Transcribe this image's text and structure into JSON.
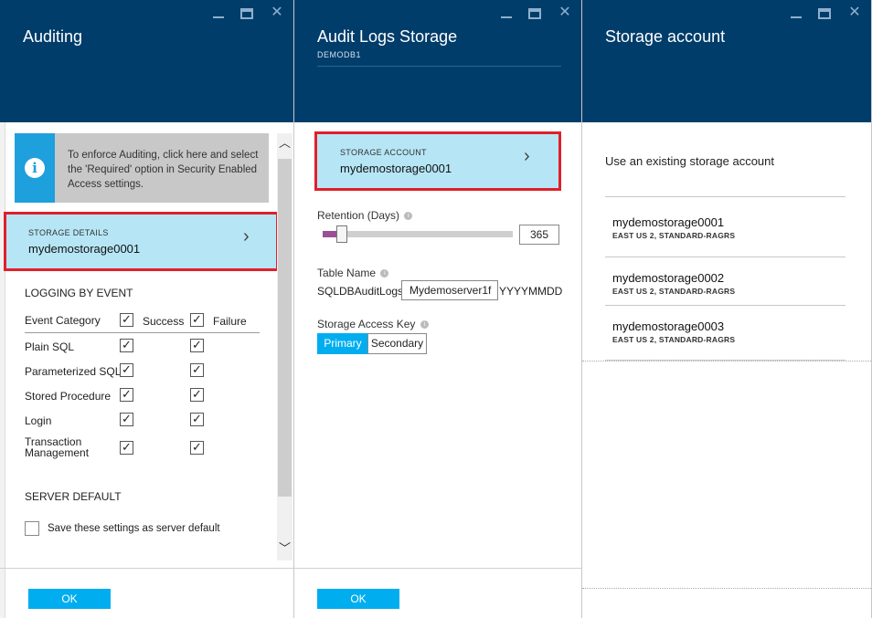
{
  "blade_auditing": {
    "title": "Auditing",
    "info_text": "To enforce Auditing, click here and select the 'Required' option in Security Enabled Access settings.",
    "storage_details_caption": "STORAGE DETAILS",
    "storage_details_value": "mydemostorage0001",
    "logging_title": "LOGGING BY EVENT",
    "event_category_header": "Event Category",
    "success_header": "Success",
    "failure_header": "Failure",
    "events": [
      {
        "label": "Plain SQL",
        "success": true,
        "failure": true
      },
      {
        "label": "Parameterized SQL",
        "success": true,
        "failure": true
      },
      {
        "label": "Stored Procedure",
        "success": true,
        "failure": true
      },
      {
        "label": "Login",
        "success": true,
        "failure": true
      },
      {
        "label": "Transaction Management",
        "success": true,
        "failure": true
      }
    ],
    "server_default_title": "SERVER DEFAULT",
    "server_default_label": "Save these settings as server default",
    "server_default_checked": false,
    "ok_label": "OK"
  },
  "blade_audit_logs": {
    "title": "Audit Logs Storage",
    "subtitle": "DEMODB1",
    "storage_account_caption": "STORAGE ACCOUNT",
    "storage_account_value": "mydemostorage0001",
    "retention_label": "Retention (Days)",
    "retention_value": "365",
    "retention_fraction": 0.1,
    "table_name_label": "Table Name",
    "table_prefix": "SQLDBAuditLogs",
    "table_server": "Mydemoserver1f",
    "table_suffix": "YYYYMMDD",
    "access_key_label": "Storage Access Key",
    "access_key_primary": "Primary",
    "access_key_secondary": "Secondary",
    "access_key_selected": "Primary",
    "ok_label": "OK"
  },
  "blade_storage_account": {
    "title": "Storage account",
    "prompt": "Use an existing storage account",
    "accounts": [
      {
        "name": "mydemostorage0001",
        "meta": "EAST US 2, STANDARD-RAGRS"
      },
      {
        "name": "mydemostorage0002",
        "meta": "EAST US 2, STANDARD-RAGRS"
      },
      {
        "name": "mydemostorage0003",
        "meta": "EAST US 2, STANDARD-RAGRS"
      }
    ]
  },
  "colors": {
    "header_bg": "#003d6b",
    "selected_bg": "#b6e6f5",
    "highlight_border": "#e0202a",
    "accent": "#00adef",
    "info_icon_bg": "#1ea0dc",
    "slider_fill": "#9b4f96"
  },
  "icons": {
    "window_controls": [
      "minimize-icon",
      "maximize-icon",
      "close-icon"
    ],
    "info": "info-icon",
    "chevron": "chevron-right-icon",
    "scroll": [
      "chevron-up-icon",
      "chevron-down-icon"
    ],
    "check": "checkmark-icon"
  }
}
